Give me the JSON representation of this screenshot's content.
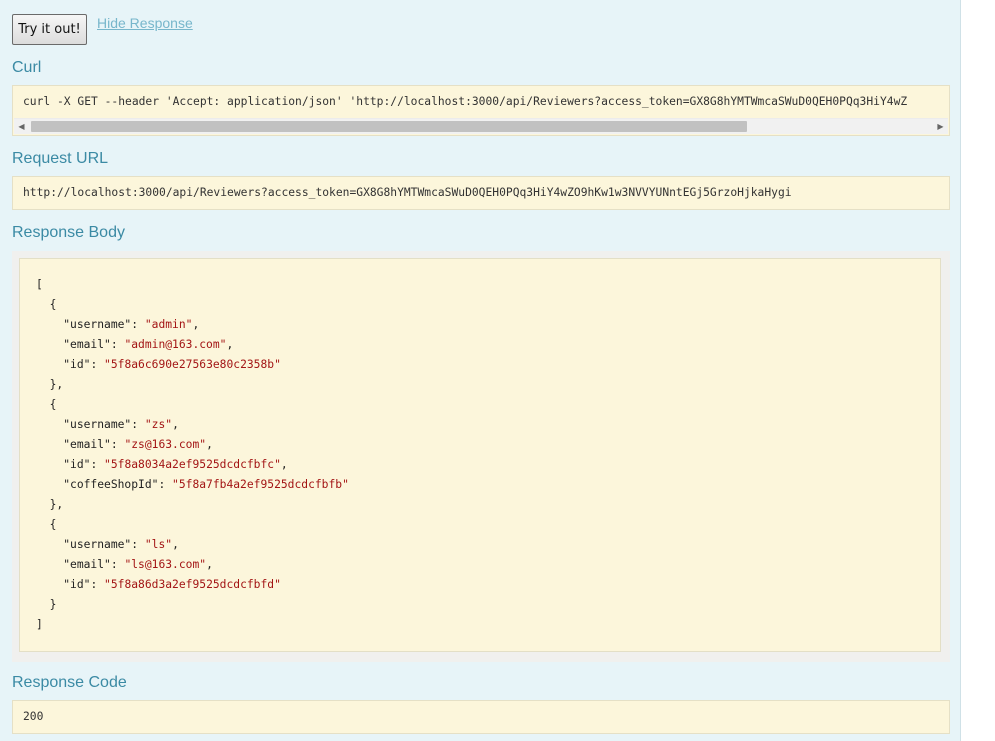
{
  "actions": {
    "try_label": "Try it out!",
    "hide_label": "Hide Response"
  },
  "curl": {
    "title": "Curl",
    "command": "curl -X GET --header 'Accept: application/json' 'http://localhost:3000/api/Reviewers?access_token=GX8G8hYMTWmcaSWuD0QEH0PQq3HiY4wZ"
  },
  "request_url": {
    "title": "Request URL",
    "value": "http://localhost:3000/api/Reviewers?access_token=GX8G8hYMTWmcaSWuD0QEH0PQq3HiY4wZO9hKw1w3NVVYUNntEGj5GrzoHjkaHygi"
  },
  "response_body": {
    "title": "Response Body",
    "lines": [
      {
        "indent": "",
        "text": "["
      },
      {
        "indent": "  ",
        "text": "{"
      },
      {
        "indent": "    ",
        "key": "\"username\"",
        "value": "\"admin\"",
        "tail": ","
      },
      {
        "indent": "    ",
        "key": "\"email\"",
        "value": "\"admin@163.com\"",
        "tail": ","
      },
      {
        "indent": "    ",
        "key": "\"id\"",
        "value": "\"5f8a6c690e27563e80c2358b\"",
        "tail": ""
      },
      {
        "indent": "  ",
        "text": "},"
      },
      {
        "indent": "  ",
        "text": "{"
      },
      {
        "indent": "    ",
        "key": "\"username\"",
        "value": "\"zs\"",
        "tail": ","
      },
      {
        "indent": "    ",
        "key": "\"email\"",
        "value": "\"zs@163.com\"",
        "tail": ","
      },
      {
        "indent": "    ",
        "key": "\"id\"",
        "value": "\"5f8a8034a2ef9525dcdcfbfc\"",
        "tail": ","
      },
      {
        "indent": "    ",
        "key": "\"coffeeShopId\"",
        "value": "\"5f8a7fb4a2ef9525dcdcfbfb\"",
        "tail": ""
      },
      {
        "indent": "  ",
        "text": "},"
      },
      {
        "indent": "  ",
        "text": "{"
      },
      {
        "indent": "    ",
        "key": "\"username\"",
        "value": "\"ls\"",
        "tail": ","
      },
      {
        "indent": "    ",
        "key": "\"email\"",
        "value": "\"ls@163.com\"",
        "tail": ","
      },
      {
        "indent": "    ",
        "key": "\"id\"",
        "value": "\"5f8a86d3a2ef9525dcdcfbfd\"",
        "tail": ""
      },
      {
        "indent": "  ",
        "text": "}"
      },
      {
        "indent": "",
        "text": "]"
      }
    ]
  },
  "response_code": {
    "title": "Response Code",
    "value": "200"
  },
  "icons": {
    "scroll_left": "left-arrow-icon",
    "scroll_right": "right-arrow-icon"
  },
  "colors": {
    "panel_background": "#e7f4f8",
    "section_title": "#3b8aa4",
    "link": "#77b6cb",
    "code_background": "#fcf6db",
    "json_string": "#a31515"
  }
}
